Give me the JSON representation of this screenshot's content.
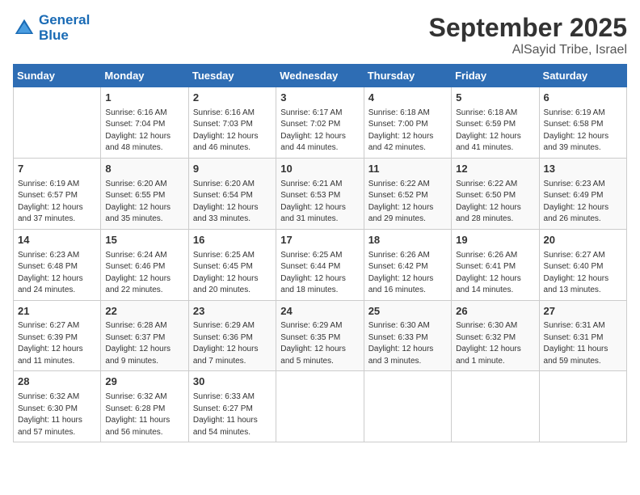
{
  "header": {
    "logo_line1": "General",
    "logo_line2": "Blue",
    "month": "September 2025",
    "location": "AlSayid Tribe, Israel"
  },
  "days_of_week": [
    "Sunday",
    "Monday",
    "Tuesday",
    "Wednesday",
    "Thursday",
    "Friday",
    "Saturday"
  ],
  "weeks": [
    [
      {
        "day": "",
        "content": ""
      },
      {
        "day": "1",
        "content": "Sunrise: 6:16 AM\nSunset: 7:04 PM\nDaylight: 12 hours\nand 48 minutes."
      },
      {
        "day": "2",
        "content": "Sunrise: 6:16 AM\nSunset: 7:03 PM\nDaylight: 12 hours\nand 46 minutes."
      },
      {
        "day": "3",
        "content": "Sunrise: 6:17 AM\nSunset: 7:02 PM\nDaylight: 12 hours\nand 44 minutes."
      },
      {
        "day": "4",
        "content": "Sunrise: 6:18 AM\nSunset: 7:00 PM\nDaylight: 12 hours\nand 42 minutes."
      },
      {
        "day": "5",
        "content": "Sunrise: 6:18 AM\nSunset: 6:59 PM\nDaylight: 12 hours\nand 41 minutes."
      },
      {
        "day": "6",
        "content": "Sunrise: 6:19 AM\nSunset: 6:58 PM\nDaylight: 12 hours\nand 39 minutes."
      }
    ],
    [
      {
        "day": "7",
        "content": "Sunrise: 6:19 AM\nSunset: 6:57 PM\nDaylight: 12 hours\nand 37 minutes."
      },
      {
        "day": "8",
        "content": "Sunrise: 6:20 AM\nSunset: 6:55 PM\nDaylight: 12 hours\nand 35 minutes."
      },
      {
        "day": "9",
        "content": "Sunrise: 6:20 AM\nSunset: 6:54 PM\nDaylight: 12 hours\nand 33 minutes."
      },
      {
        "day": "10",
        "content": "Sunrise: 6:21 AM\nSunset: 6:53 PM\nDaylight: 12 hours\nand 31 minutes."
      },
      {
        "day": "11",
        "content": "Sunrise: 6:22 AM\nSunset: 6:52 PM\nDaylight: 12 hours\nand 29 minutes."
      },
      {
        "day": "12",
        "content": "Sunrise: 6:22 AM\nSunset: 6:50 PM\nDaylight: 12 hours\nand 28 minutes."
      },
      {
        "day": "13",
        "content": "Sunrise: 6:23 AM\nSunset: 6:49 PM\nDaylight: 12 hours\nand 26 minutes."
      }
    ],
    [
      {
        "day": "14",
        "content": "Sunrise: 6:23 AM\nSunset: 6:48 PM\nDaylight: 12 hours\nand 24 minutes."
      },
      {
        "day": "15",
        "content": "Sunrise: 6:24 AM\nSunset: 6:46 PM\nDaylight: 12 hours\nand 22 minutes."
      },
      {
        "day": "16",
        "content": "Sunrise: 6:25 AM\nSunset: 6:45 PM\nDaylight: 12 hours\nand 20 minutes."
      },
      {
        "day": "17",
        "content": "Sunrise: 6:25 AM\nSunset: 6:44 PM\nDaylight: 12 hours\nand 18 minutes."
      },
      {
        "day": "18",
        "content": "Sunrise: 6:26 AM\nSunset: 6:42 PM\nDaylight: 12 hours\nand 16 minutes."
      },
      {
        "day": "19",
        "content": "Sunrise: 6:26 AM\nSunset: 6:41 PM\nDaylight: 12 hours\nand 14 minutes."
      },
      {
        "day": "20",
        "content": "Sunrise: 6:27 AM\nSunset: 6:40 PM\nDaylight: 12 hours\nand 13 minutes."
      }
    ],
    [
      {
        "day": "21",
        "content": "Sunrise: 6:27 AM\nSunset: 6:39 PM\nDaylight: 12 hours\nand 11 minutes."
      },
      {
        "day": "22",
        "content": "Sunrise: 6:28 AM\nSunset: 6:37 PM\nDaylight: 12 hours\nand 9 minutes."
      },
      {
        "day": "23",
        "content": "Sunrise: 6:29 AM\nSunset: 6:36 PM\nDaylight: 12 hours\nand 7 minutes."
      },
      {
        "day": "24",
        "content": "Sunrise: 6:29 AM\nSunset: 6:35 PM\nDaylight: 12 hours\nand 5 minutes."
      },
      {
        "day": "25",
        "content": "Sunrise: 6:30 AM\nSunset: 6:33 PM\nDaylight: 12 hours\nand 3 minutes."
      },
      {
        "day": "26",
        "content": "Sunrise: 6:30 AM\nSunset: 6:32 PM\nDaylight: 12 hours\nand 1 minute."
      },
      {
        "day": "27",
        "content": "Sunrise: 6:31 AM\nSunset: 6:31 PM\nDaylight: 11 hours\nand 59 minutes."
      }
    ],
    [
      {
        "day": "28",
        "content": "Sunrise: 6:32 AM\nSunset: 6:30 PM\nDaylight: 11 hours\nand 57 minutes."
      },
      {
        "day": "29",
        "content": "Sunrise: 6:32 AM\nSunset: 6:28 PM\nDaylight: 11 hours\nand 56 minutes."
      },
      {
        "day": "30",
        "content": "Sunrise: 6:33 AM\nSunset: 6:27 PM\nDaylight: 11 hours\nand 54 minutes."
      },
      {
        "day": "",
        "content": ""
      },
      {
        "day": "",
        "content": ""
      },
      {
        "day": "",
        "content": ""
      },
      {
        "day": "",
        "content": ""
      }
    ]
  ]
}
